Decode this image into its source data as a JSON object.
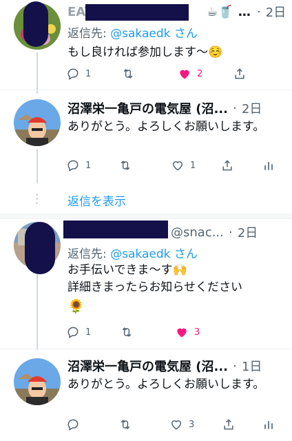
{
  "tweets": [
    {
      "name": "EAT",
      "handle_icons": "☕🥤",
      "time": "2日",
      "reply_prefix": "返信先: ",
      "reply_mention": "@sakaedk さん",
      "text": "もし良ければ参加します〜☺️",
      "reply_count": "1",
      "retweet_count": "",
      "like_count": "2",
      "liked": true
    },
    {
      "name": "沼澤栄一亀戸の電気屋 (沼...",
      "time": "2日",
      "text": "ありがとう。よろしくお願いします。",
      "reply_count": "1",
      "retweet_count": "",
      "like_count": "1",
      "liked": false
    },
    {
      "handle": "@snac...",
      "time": "2日",
      "reply_prefix": "返信先: ",
      "reply_mention": "@sakaedk さん",
      "text_line1": "お手伝いできま〜す🙌",
      "text_line2": "詳細きまったらお知らせください",
      "text_line3": "🌻",
      "reply_count": "1",
      "retweet_count": "",
      "like_count": "3",
      "liked": true
    },
    {
      "name": "沼澤栄一亀戸の電気屋 (沼...",
      "time": "1日",
      "text": "ありがとう。よろしくお願いします。",
      "reply_count": "",
      "retweet_count": "",
      "like_count": "3",
      "liked": false
    }
  ],
  "show_replies": "返信を表示",
  "colors": {
    "accent": "#1d9bf0",
    "like": "#f91880",
    "muted": "#536471"
  },
  "icons": [
    "reply-icon",
    "retweet-icon",
    "like-icon",
    "share-icon",
    "analytics-icon"
  ]
}
